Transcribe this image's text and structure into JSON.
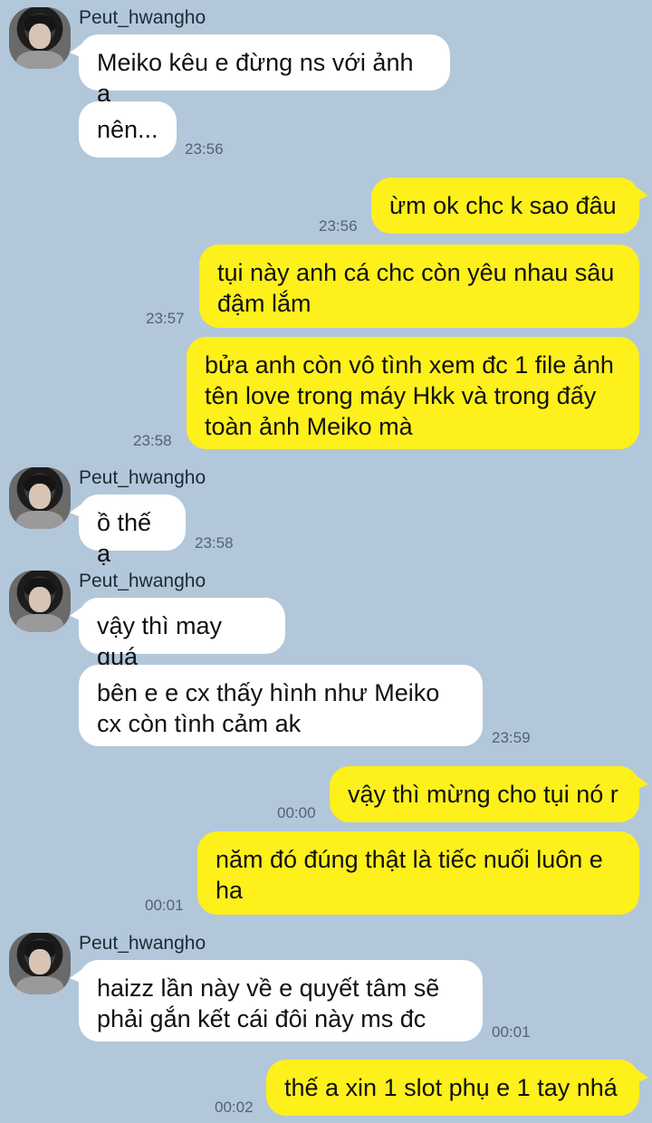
{
  "chat": {
    "contact_name": "Peut_hwangho",
    "messages": [
      {
        "sender": "Peut_hwangho",
        "text": "Meiko kêu e đừng ns với ảnh ạ",
        "time": ""
      },
      {
        "sender": "Peut_hwangho",
        "text": "nên...",
        "time": "23:56"
      },
      {
        "sender": "me",
        "text": "ừm ok chc k sao đâu",
        "time": "23:56"
      },
      {
        "sender": "me",
        "text": "tụi này anh cá chc còn yêu nhau sâu đậm lắm",
        "time": "23:57"
      },
      {
        "sender": "me",
        "text": "bửa anh còn vô tình xem đc 1 file ảnh tên love trong máy Hkk và trong đấy toàn ảnh Meiko mà",
        "time": "23:58"
      },
      {
        "sender": "Peut_hwangho",
        "text": "ồ thế ạ",
        "time": "23:58"
      },
      {
        "sender": "Peut_hwangho",
        "text": "vậy thì may quá",
        "time": ""
      },
      {
        "sender": "Peut_hwangho",
        "text": "bên e e cx thấy hình như Meiko cx còn tình cảm ak",
        "time": "23:59"
      },
      {
        "sender": "me",
        "text": "vậy thì mừng cho tụi nó r",
        "time": "00:00"
      },
      {
        "sender": "me",
        "text": "năm đó đúng thật là tiếc nuối luôn e ha",
        "time": "00:01"
      },
      {
        "sender": "Peut_hwangho",
        "text": "haizz lần này về e quyết tâm sẽ phải gắn kết cái đôi này ms đc",
        "time": "00:01"
      },
      {
        "sender": "me",
        "text": "thế a xin 1 slot phụ e 1 tay nhá",
        "time": "00:02"
      }
    ]
  },
  "colors": {
    "background": "#b2c7da",
    "incoming_bubble": "#ffffff",
    "outgoing_bubble": "#fef01b"
  }
}
